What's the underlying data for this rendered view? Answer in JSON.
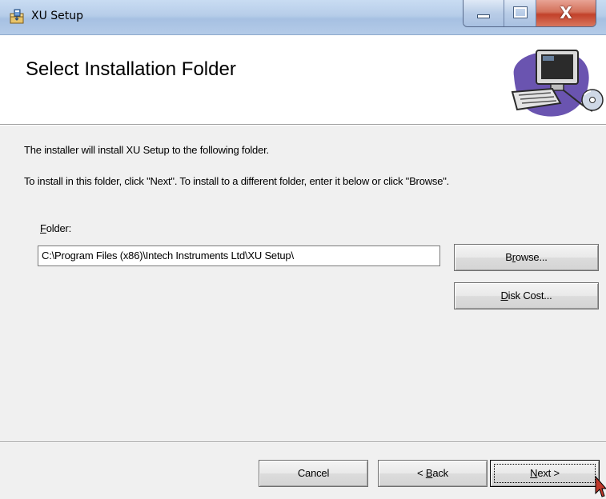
{
  "window": {
    "title": "XU Setup",
    "icon": "installer-icon",
    "controls": {
      "minimize": "minimize-icon",
      "maximize": "maximize-icon",
      "close_glyph": "X"
    }
  },
  "banner": {
    "title": "Select Installation Folder",
    "art": "computer-cd-icon"
  },
  "content": {
    "line1": "The installer will install XU Setup to the following folder.",
    "line2": "To install in this folder, click \"Next\". To install to a different folder, enter it below or click \"Browse\".",
    "folder": {
      "label_mnemonic": "F",
      "label_rest": "older:",
      "value": "C:\\Program Files (x86)\\Intech Instruments Ltd\\XU Setup\\"
    },
    "browse": {
      "pre": "B",
      "mnemonic": "r",
      "post": "owse..."
    },
    "disk_cost": {
      "pre": "",
      "mnemonic": "D",
      "post": "isk Cost..."
    }
  },
  "footer": {
    "cancel": "Cancel",
    "back": {
      "pre": "< ",
      "mnemonic": "B",
      "post": "ack"
    },
    "next": {
      "pre": "",
      "mnemonic": "N",
      "post": "ext >"
    }
  },
  "colors": {
    "title_bar": "#b6cde9",
    "close_button": "#c2412a",
    "dialog_bg": "#f0f0f0"
  }
}
